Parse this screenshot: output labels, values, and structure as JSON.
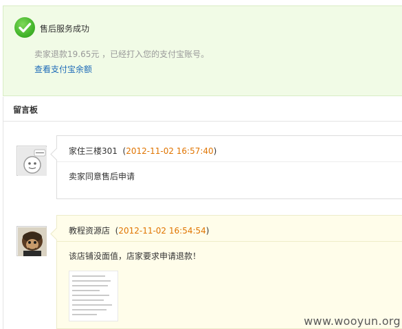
{
  "success": {
    "title": "售后服务成功",
    "description": "卖家退款19.65元 ，已经打入您的支付宝账号。",
    "link_label": "查看支付宝余额",
    "icon": "check-circle-icon",
    "accent_color": "#43b52b"
  },
  "board": {
    "title": "留言板"
  },
  "messages": [
    {
      "author": "家住三楼301",
      "date": "2012-11-02 16:57:40",
      "body": "卖家同意售后申请",
      "avatar": "default-avatar-icon"
    },
    {
      "author": "教程资源店",
      "date": "2012-11-02 16:54:54",
      "body": "该店铺没面值，店家要求申请退款！",
      "avatar": "monkey-avatar-icon",
      "attachment": "screenshot-thumbnail"
    }
  ],
  "watermark": "www.wooyun.org",
  "colors": {
    "date": "#e07400",
    "link": "#1e6bb8",
    "success_bg": "#f1fbe6",
    "highlight_bg": "#fffdea"
  }
}
